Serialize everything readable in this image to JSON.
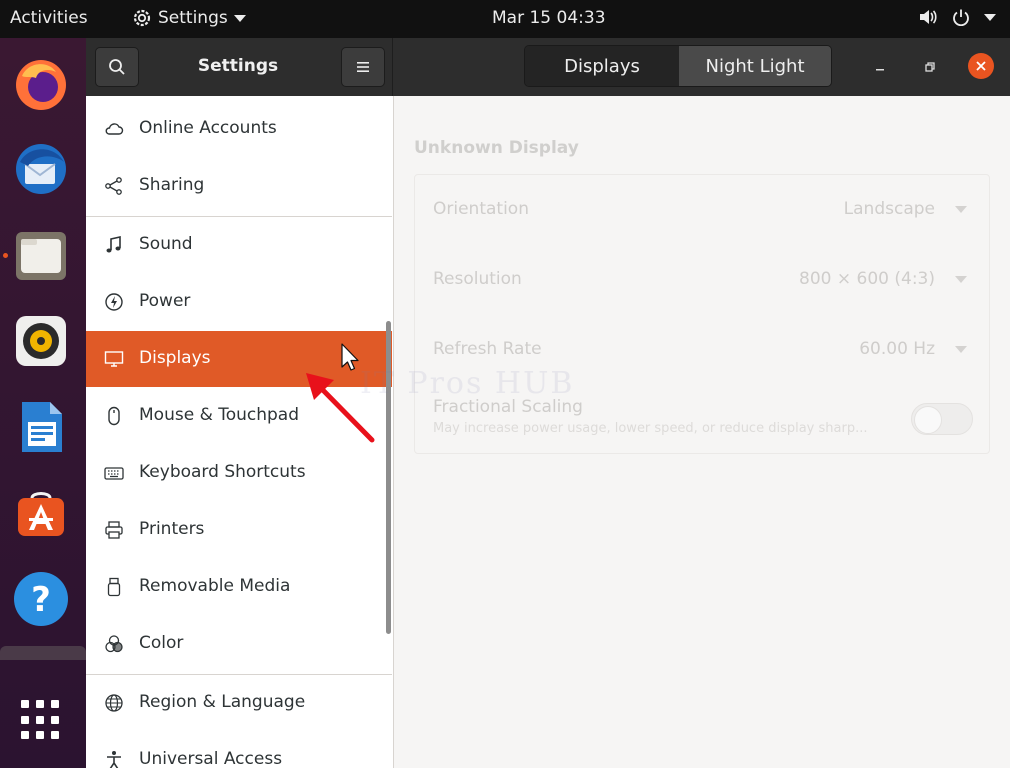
{
  "topbar": {
    "activities": "Activities",
    "app_menu": "Settings",
    "clock": "Mar 15  04:33",
    "icons": [
      "volume-icon",
      "power-icon",
      "chevron-down-icon"
    ]
  },
  "dock": {
    "apps": [
      "firefox",
      "thunderbird",
      "files",
      "rhythmbox",
      "libreoffice-writer",
      "software",
      "help"
    ]
  },
  "window": {
    "title": "Settings",
    "tabs": [
      {
        "label": "Displays",
        "active": true
      },
      {
        "label": "Night Light",
        "active": false
      }
    ]
  },
  "sidebar": {
    "items": [
      {
        "label": "Online Accounts",
        "icon": "cloud-icon"
      },
      {
        "label": "Sharing",
        "icon": "share-icon"
      },
      {
        "label": "Sound",
        "icon": "music-note-icon"
      },
      {
        "label": "Power",
        "icon": "power-icon"
      },
      {
        "label": "Displays",
        "icon": "display-icon",
        "selected": true
      },
      {
        "label": "Mouse & Touchpad",
        "icon": "mouse-icon"
      },
      {
        "label": "Keyboard Shortcuts",
        "icon": "keyboard-icon"
      },
      {
        "label": "Printers",
        "icon": "printer-icon"
      },
      {
        "label": "Removable Media",
        "icon": "usb-icon"
      },
      {
        "label": "Color",
        "icon": "color-icon"
      },
      {
        "label": "Region & Language",
        "icon": "globe-icon"
      },
      {
        "label": "Universal Access",
        "icon": "accessibility-icon"
      }
    ]
  },
  "display": {
    "name": "Unknown Display",
    "orientation": {
      "label": "Orientation",
      "value": "Landscape"
    },
    "resolution": {
      "label": "Resolution",
      "value": "800 × 600 (4:3)"
    },
    "refresh_rate": {
      "label": "Refresh Rate",
      "value": "60.00 Hz"
    },
    "fractional_scaling": {
      "label": "Fractional Scaling",
      "description": "May increase power usage, lower speed, or reduce display sharp...",
      "enabled": false
    }
  },
  "watermark": "IT Pros HUB",
  "colors": {
    "accent": "#e95420",
    "selected_row": "#e05a27",
    "headerbar": "#2d2d2d",
    "topbar": "#111111",
    "dock": "#2b1330"
  }
}
